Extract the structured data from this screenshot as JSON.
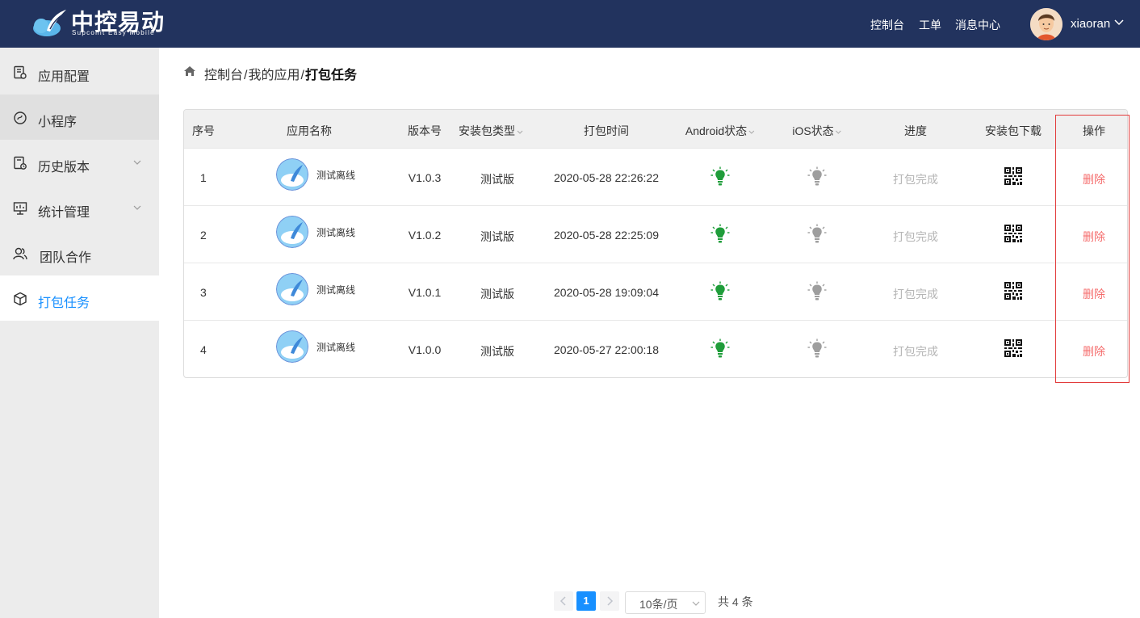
{
  "header": {
    "logo_title": "中控易动",
    "logo_subtitle": "Supconit Easy Mobile",
    "nav": [
      {
        "label": "控制台"
      },
      {
        "label": "工单"
      },
      {
        "label": "消息中心"
      }
    ],
    "username": "xiaoran",
    "bg_color": "#22335e"
  },
  "sidebar": {
    "items": [
      {
        "label": "应用配置",
        "icon": "app-config-icon"
      },
      {
        "label": "小程序",
        "icon": "mini-program-icon"
      },
      {
        "label": "历史版本",
        "icon": "history-version-icon"
      },
      {
        "label": "统计管理",
        "icon": "statistics-icon"
      },
      {
        "label": "团队合作",
        "icon": "team-icon"
      },
      {
        "label": "打包任务",
        "icon": "package-icon"
      }
    ],
    "active_color": "#1890ff"
  },
  "breadcrumb": {
    "items": [
      "控制台",
      "我的应用",
      "打包任务"
    ],
    "separator": "/"
  },
  "table": {
    "columns": [
      "序号",
      "应用名称",
      "版本号",
      "安装包类型",
      "打包时间",
      "Android状态",
      "iOS状态",
      "进度",
      "安装包下载",
      "操作"
    ],
    "rows": [
      {
        "seq": "1",
        "app_name": "测试离线",
        "version": "V1.0.3",
        "pkg_type": "测试版",
        "time": "2020-05-28 22:26:22",
        "android": "on",
        "ios": "off",
        "progress": "打包完成",
        "action": "删除"
      },
      {
        "seq": "2",
        "app_name": "测试离线",
        "version": "V1.0.2",
        "pkg_type": "测试版",
        "time": "2020-05-28 22:25:09",
        "android": "on",
        "ios": "off",
        "progress": "打包完成",
        "action": "删除"
      },
      {
        "seq": "3",
        "app_name": "测试离线",
        "version": "V1.0.1",
        "pkg_type": "测试版",
        "time": "2020-05-28 19:09:04",
        "android": "on",
        "ios": "off",
        "progress": "打包完成",
        "action": "删除"
      },
      {
        "seq": "4",
        "app_name": "测试离线",
        "version": "V1.0.0",
        "pkg_type": "测试版",
        "time": "2020-05-27 22:00:18",
        "android": "on",
        "ios": "off",
        "progress": "打包完成",
        "action": "删除"
      }
    ],
    "status_on_color": "#1f9d3a",
    "status_off_color": "#9e9e9e",
    "delete_color": "#f56c6c"
  },
  "pagination": {
    "current_page": "1",
    "page_size": "10条/页",
    "total": "共 4 条"
  }
}
